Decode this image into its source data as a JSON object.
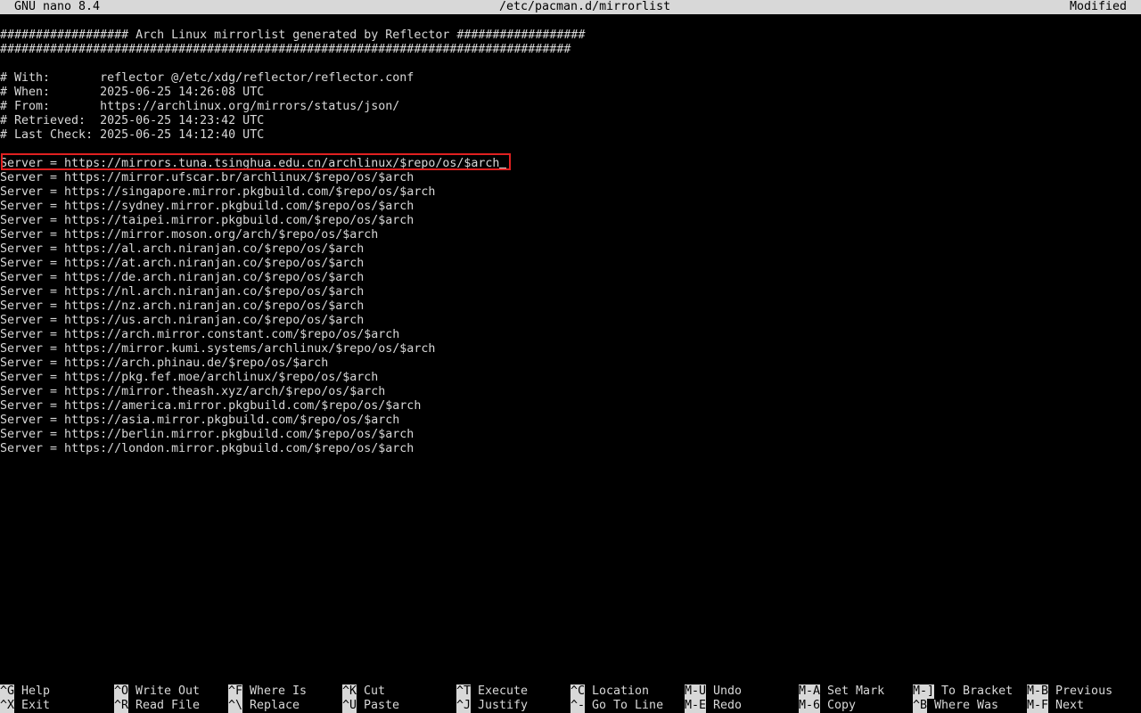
{
  "titlebar": {
    "app": "GNU nano 8.4",
    "file": "/etc/pacman.d/mirrorlist",
    "status": "Modified"
  },
  "buffer": {
    "lines": [
      "################## Arch Linux mirrorlist generated by Reflector ##################",
      "################################################################################",
      "",
      "# With:       reflector @/etc/xdg/reflector/reflector.conf",
      "# When:       2025-06-25 14:26:08 UTC",
      "# From:       https://archlinux.org/mirrors/status/json/",
      "# Retrieved:  2025-06-25 14:23:42 UTC",
      "# Last Check: 2025-06-25 14:12:40 UTC",
      "",
      "Server = https://mirrors.tuna.tsinghua.edu.cn/archlinux/$repo/os/$arch",
      "Server = https://mirror.ufscar.br/archlinux/$repo/os/$arch",
      "Server = https://singapore.mirror.pkgbuild.com/$repo/os/$arch",
      "Server = https://sydney.mirror.pkgbuild.com/$repo/os/$arch",
      "Server = https://taipei.mirror.pkgbuild.com/$repo/os/$arch",
      "Server = https://mirror.moson.org/arch/$repo/os/$arch",
      "Server = https://al.arch.niranjan.co/$repo/os/$arch",
      "Server = https://at.arch.niranjan.co/$repo/os/$arch",
      "Server = https://de.arch.niranjan.co/$repo/os/$arch",
      "Server = https://nl.arch.niranjan.co/$repo/os/$arch",
      "Server = https://nz.arch.niranjan.co/$repo/os/$arch",
      "Server = https://us.arch.niranjan.co/$repo/os/$arch",
      "Server = https://arch.mirror.constant.com/$repo/os/$arch",
      "Server = https://mirror.kumi.systems/archlinux/$repo/os/$arch",
      "Server = https://arch.phinau.de/$repo/os/$arch",
      "Server = https://pkg.fef.moe/archlinux/$repo/os/$arch",
      "Server = https://mirror.theash.xyz/arch/$repo/os/$arch",
      "Server = https://america.mirror.pkgbuild.com/$repo/os/$arch",
      "Server = https://asia.mirror.pkgbuild.com/$repo/os/$arch",
      "Server = https://berlin.mirror.pkgbuild.com/$repo/os/$arch",
      "Server = https://london.mirror.pkgbuild.com/$repo/os/$arch"
    ]
  },
  "shortcuts": [
    {
      "key": "^G",
      "label": "Help"
    },
    {
      "key": "^X",
      "label": "Exit"
    },
    {
      "key": "^O",
      "label": "Write Out"
    },
    {
      "key": "^R",
      "label": "Read File"
    },
    {
      "key": "^F",
      "label": "Where Is"
    },
    {
      "key": "^\\",
      "label": "Replace"
    },
    {
      "key": "^K",
      "label": "Cut"
    },
    {
      "key": "^U",
      "label": "Paste"
    },
    {
      "key": "^T",
      "label": "Execute"
    },
    {
      "key": "^J",
      "label": "Justify"
    },
    {
      "key": "^C",
      "label": "Location"
    },
    {
      "key": "^-",
      "label": "Go To Line"
    },
    {
      "key": "M-U",
      "label": "Undo"
    },
    {
      "key": "M-E",
      "label": "Redo"
    },
    {
      "key": "M-A",
      "label": "Set Mark"
    },
    {
      "key": "M-6",
      "label": "Copy"
    },
    {
      "key": "M-]",
      "label": "To Bracket"
    },
    {
      "key": "^B",
      "label": "Where Was"
    },
    {
      "key": "M-B",
      "label": "Previous"
    },
    {
      "key": "M-F",
      "label": "Next"
    }
  ],
  "colors": {
    "background": "#000000",
    "foreground": "#d8d8d8",
    "highlight_box": "#e02020"
  }
}
